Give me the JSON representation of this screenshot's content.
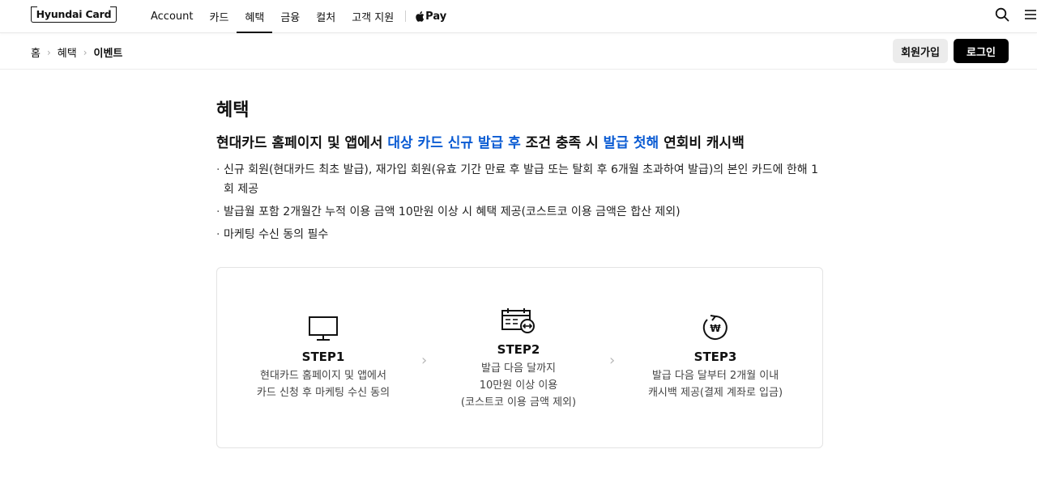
{
  "header": {
    "logo_text": "Hyundai Card",
    "nav": [
      {
        "label": "Account"
      },
      {
        "label": "카드"
      },
      {
        "label": "혜택"
      },
      {
        "label": "금융"
      },
      {
        "label": "컬처"
      },
      {
        "label": "고객 지원"
      }
    ],
    "active_nav": "혜택",
    "apple_pay_label": "Pay"
  },
  "breadcrumb": [
    "홈",
    "혜택",
    "이벤트"
  ],
  "auth": {
    "join_label": "회원가입",
    "login_label": "로그인"
  },
  "page": {
    "title": "혜택",
    "headline": {
      "part1": "현대카드 홈페이지 및 앱에서 ",
      "highlight1": "대상 카드 신규 발급 후",
      "part2": " 조건 충족 시 ",
      "highlight2": "발급 첫해",
      "part3": " 연회비 캐시백"
    },
    "bullets": [
      "신규 회원(현대카드 최초 발급), 재가입 회원(유효 기간 만료 후 발급 또는 탈회 후 6개월 초과하여 발급)의 본인 카드에 한해 1회 제공",
      "발급월 포함 2개월간 누적 이용 금액 10만원 이상 시 혜택 제공(코스트코 이용 금액은 합산 제외)",
      "마케팅 수신 동의 필수"
    ]
  },
  "steps": [
    {
      "title": "STEP1",
      "lines": [
        "현대카드 홈페이지 및 앱에서",
        "카드 신청 후 마케팅 수신 동의"
      ],
      "icon": "monitor-icon"
    },
    {
      "title": "STEP2",
      "lines": [
        "발급 다음 달까지",
        "10만원 이상 이용",
        "(코스트코 이용 금액 제외)"
      ],
      "icon": "calendar-exchange-icon"
    },
    {
      "title": "STEP3",
      "lines": [
        "발급 다음 달부터 2개월 이내",
        "캐시백 제공(결제 계좌로 입금)"
      ],
      "icon": "won-cashback-icon"
    }
  ],
  "colors": {
    "accent": "#0a5bd3",
    "login_bg": "#000000",
    "join_bg": "#ececec"
  }
}
